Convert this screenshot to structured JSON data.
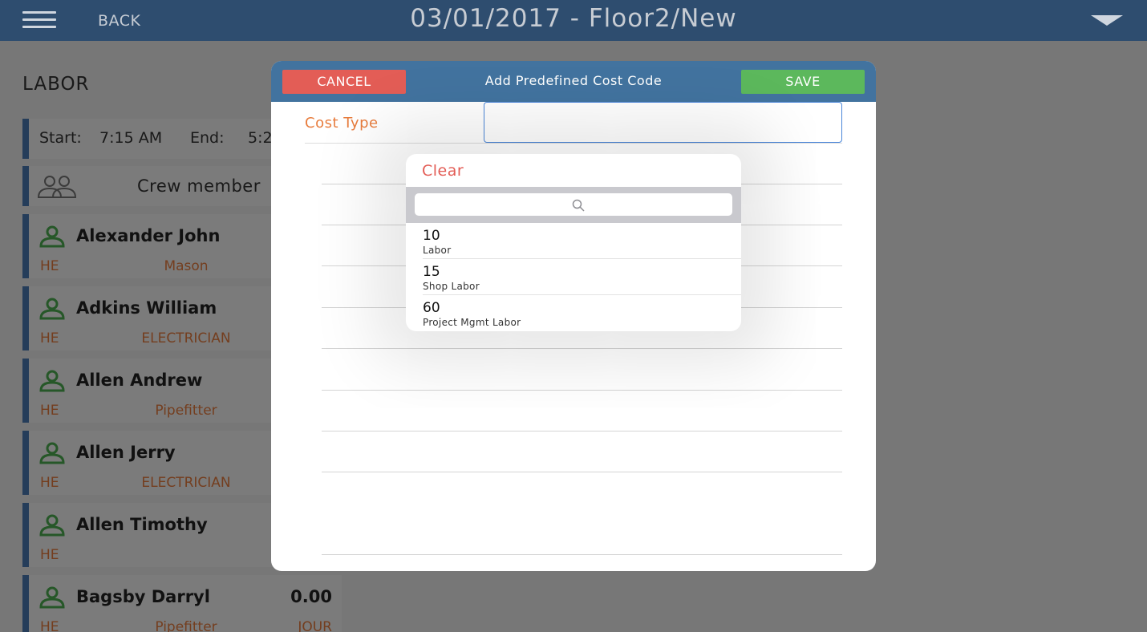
{
  "topbar": {
    "back_label": "BACK",
    "title": "03/01/2017 - Floor2/New"
  },
  "section": {
    "title": "LABOR"
  },
  "time": {
    "start_label": "Start:",
    "start_value": "7:15 AM",
    "end_label": "End:",
    "end_value": "5:2"
  },
  "crew": {
    "label": "Crew member"
  },
  "members": [
    {
      "name": "Alexander John",
      "hours": "",
      "class": "HE",
      "trade": "Mason",
      "level": ""
    },
    {
      "name": "Adkins William",
      "hours": "",
      "class": "HE",
      "trade": "ELECTRICIAN",
      "level": ""
    },
    {
      "name": "Allen Andrew",
      "hours": "",
      "class": "HE",
      "trade": "Pipefitter",
      "level": ""
    },
    {
      "name": "Allen Jerry",
      "hours": "",
      "class": "HE",
      "trade": "ELECTRICIAN",
      "level": ""
    },
    {
      "name": "Allen Timothy",
      "hours": "",
      "class": "HE",
      "trade": "",
      "level": ""
    },
    {
      "name": "Bagsby Darryl",
      "hours": "0.00",
      "class": "HE",
      "trade": "Pipefitter",
      "level": "JOUR"
    }
  ],
  "modal": {
    "cancel_label": "CANCEL",
    "title": "Add Predefined Cost Code",
    "save_label": "SAVE",
    "cost_type_label": "Cost Type",
    "cost_type_value": ""
  },
  "popover": {
    "clear_label": "Clear",
    "search_value": "",
    "options": [
      {
        "code": "10",
        "description": "Labor"
      },
      {
        "code": "15",
        "description": "Shop Labor"
      },
      {
        "code": "60",
        "description": "Project Mgmt Labor"
      }
    ]
  },
  "colors": {
    "topbar": "#2e4d6f",
    "modal_header": "#42739f",
    "cancel": "#e35d56",
    "save": "#5cb85c",
    "accent_orange": "#e87d3e",
    "person_icon": "#4caf50",
    "card_border": "#4a7bb5"
  },
  "icons": {
    "menu": "hamburger-icon",
    "dropdown": "chevron-down-icon",
    "crew": "crew-icon",
    "person": "person-icon",
    "search": "search-icon"
  }
}
